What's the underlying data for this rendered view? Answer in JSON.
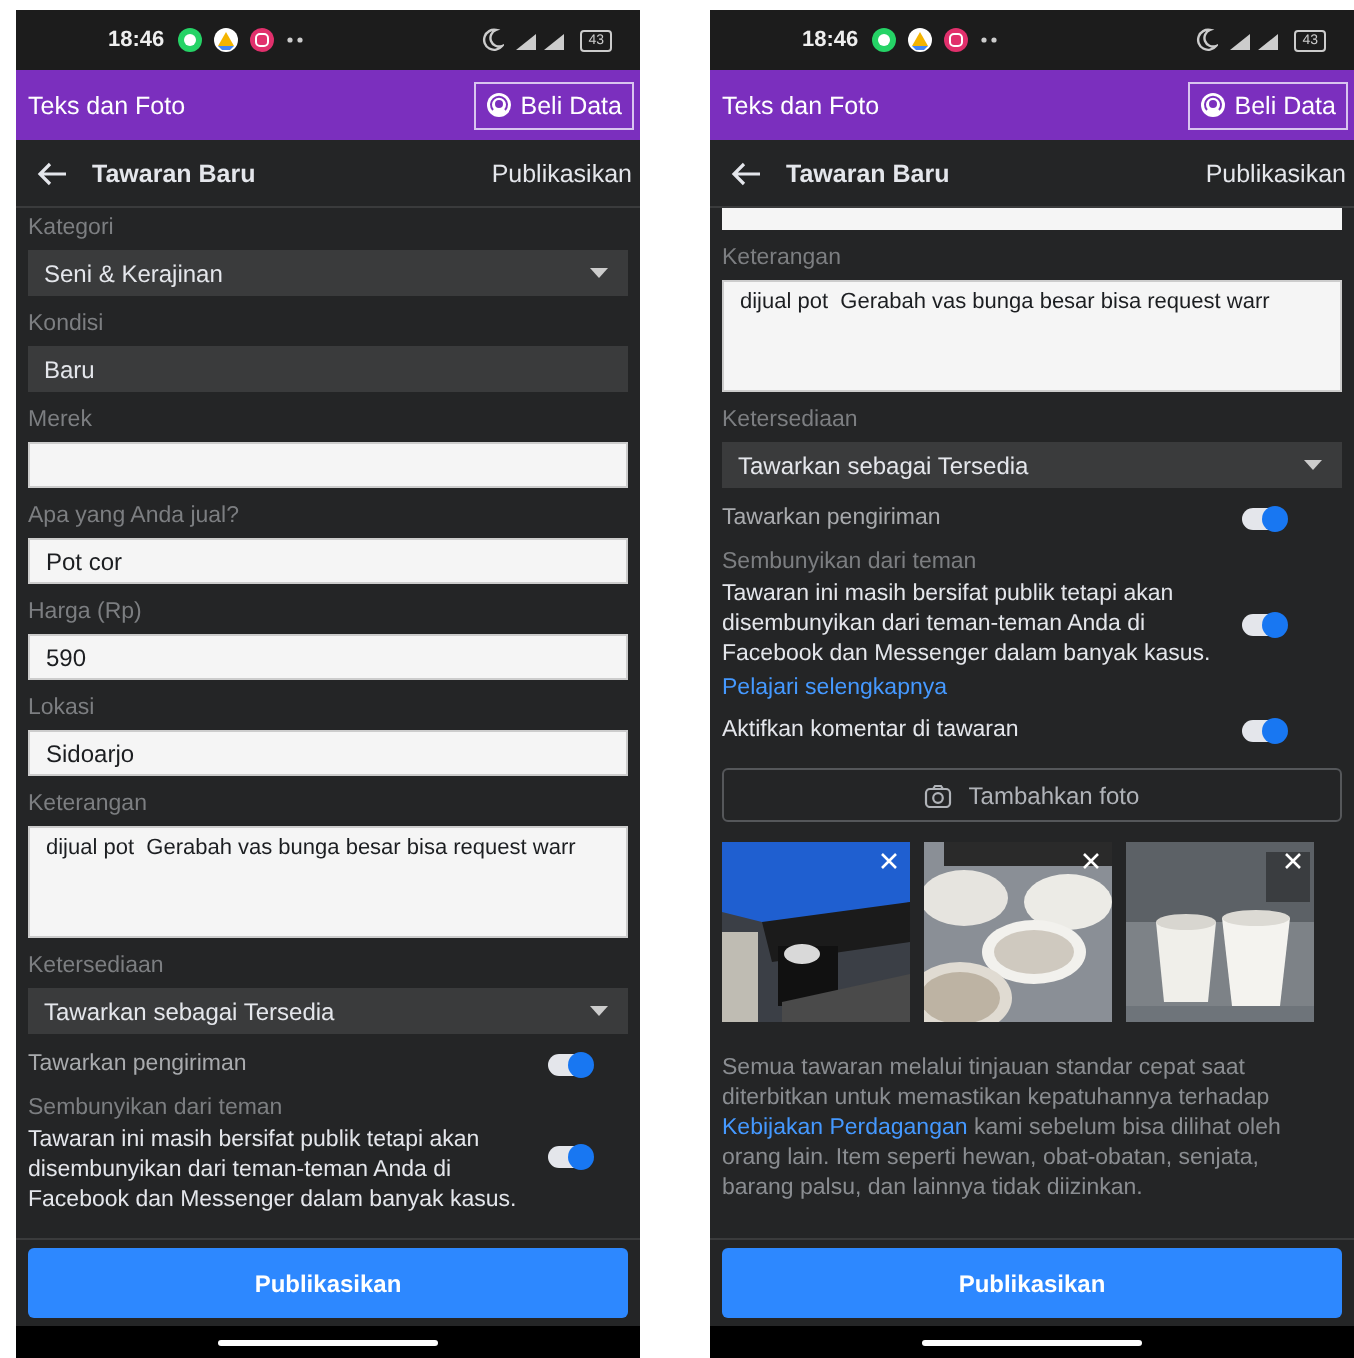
{
  "phones": [
    {
      "status": {
        "time": "18:46",
        "battery": "43"
      },
      "app_bar": {
        "title": "Teks dan Foto",
        "button": "Beli Data"
      },
      "header": {
        "title": "Tawaran Baru",
        "action": "Publikasikan"
      },
      "form": [
        {
          "kind": "select",
          "label": "Kategori",
          "value": "Seni & Kerajinan"
        },
        {
          "kind": "readonly",
          "label": "Kondisi",
          "value": "Baru"
        },
        {
          "kind": "input",
          "label": "Merek"
        },
        {
          "kind": "input",
          "label": "Apa yang Anda jual?",
          "value": "Pot cor"
        },
        {
          "kind": "input",
          "label": "Harga (Rp)",
          "value": "590"
        },
        {
          "kind": "input",
          "label": "Lokasi",
          "value": "Sidoarjo"
        },
        {
          "kind": "textarea",
          "label": "Keterangan",
          "value": "dijual pot  Gerabah vas bunga besar bisa request warr"
        },
        {
          "kind": "select",
          "label": "Ketersediaan",
          "value": "Tawarkan sebagai Tersedia"
        },
        {
          "kind": "toggle",
          "label": "Tawarkan pengiriman",
          "muted": true,
          "on": true
        },
        {
          "kind": "toggle",
          "heading": "Sembunyikan dari teman",
          "label": "Tawaran ini masih bersifat publik tetapi akan disembunyikan dari teman-teman Anda di Facebook dan Messenger dalam banyak kasus.",
          "muted": false,
          "on": true
        }
      ],
      "footer_button": "Publikasikan"
    },
    {
      "status": {
        "time": "18:46",
        "battery": "43"
      },
      "app_bar": {
        "title": "Teks dan Foto",
        "button": "Beli Data"
      },
      "header": {
        "title": "Tawaran Baru",
        "action": "Publikasikan"
      },
      "form": [
        {
          "kind": "cut"
        },
        {
          "kind": "textarea",
          "label": "Keterangan",
          "value": "dijual pot  Gerabah vas bunga besar bisa request warr"
        },
        {
          "kind": "select",
          "label": "Ketersediaan",
          "value": "Tawarkan sebagai Tersedia"
        },
        {
          "kind": "toggle",
          "label": "Tawarkan pengiriman",
          "muted": true,
          "on": true
        },
        {
          "kind": "toggle",
          "heading": "Sembunyikan dari teman",
          "label": "Tawaran ini masih bersifat publik tetapi akan disembunyikan dari teman-teman Anda di Facebook dan Messenger dalam banyak kasus.",
          "link": "Pelajari selengkapnya",
          "muted": false,
          "on": true
        },
        {
          "kind": "toggle",
          "label": "Aktifkan komentar di tawaran",
          "muted": false,
          "on": true
        },
        {
          "kind": "photo_button",
          "label": "Tambahkan foto"
        },
        {
          "kind": "photos"
        },
        {
          "kind": "note",
          "before": "Semua tawaran melalui tinjauan standar cepat saat diterbitkan untuk memastikan kepatuhannya terhadap",
          "link": "Kebijakan Perdagangan",
          "after": "kami sebelum bisa dilihat oleh orang lain. Item seperti hewan, obat-obatan, senjata, barang palsu, dan lainnya tidak diizinkan."
        }
      ],
      "footer_button": "Publikasikan"
    }
  ]
}
